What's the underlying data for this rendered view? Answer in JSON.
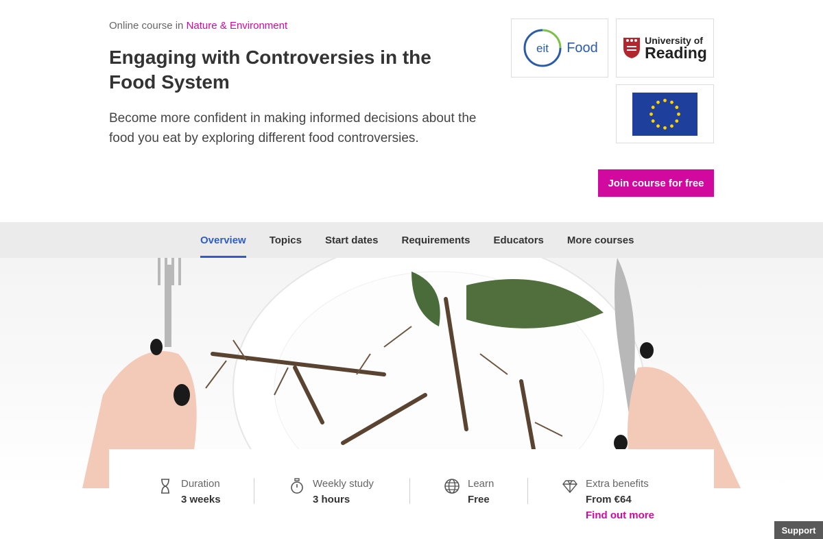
{
  "header": {
    "category_prefix": "Online course in",
    "category_link": "Nature & Environment",
    "title": "Engaging with Controversies in the Food System",
    "description": "Become more confident in making informed decisions about the food you eat by exploring different food controversies.",
    "join_label": "Join course for free"
  },
  "logos": {
    "eit_mark": "eit",
    "eit_text": "Food",
    "reading_small": "University of",
    "reading_big": "Reading"
  },
  "nav": {
    "tabs": [
      {
        "label": "Overview",
        "active": true
      },
      {
        "label": "Topics"
      },
      {
        "label": "Start dates"
      },
      {
        "label": "Requirements"
      },
      {
        "label": "Educators"
      },
      {
        "label": "More courses"
      }
    ]
  },
  "info": {
    "duration": {
      "label": "Duration",
      "value": "3 weeks",
      "icon": "hourglass-icon"
    },
    "weekly": {
      "label": "Weekly study",
      "value": "3 hours",
      "icon": "stopwatch-icon"
    },
    "learn": {
      "label": "Learn",
      "value": "Free",
      "icon": "globe-icon"
    },
    "extra": {
      "label": "Extra benefits",
      "value": "From €64",
      "link": "Find out more",
      "icon": "diamond-icon"
    }
  },
  "support_label": "Support",
  "colors": {
    "brand_pink": "#d1099f",
    "nav_active_blue": "#2f5cc8",
    "eu_blue": "#1f3f9c",
    "eu_star": "#ffd400"
  }
}
